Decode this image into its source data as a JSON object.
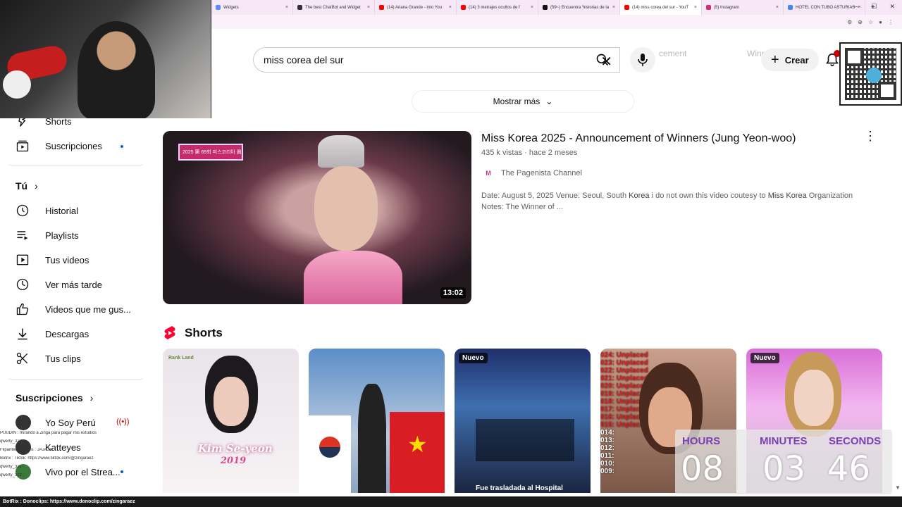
{
  "browser": {
    "tabs": [
      {
        "label": "Widgets",
        "color": "#5b8cff"
      },
      {
        "label": "The best ChatBot and Widget",
        "color": "#333"
      },
      {
        "label": "(14) Ariana Grande - Into You",
        "color": "#ff0000"
      },
      {
        "label": "(14) 3 metrajes ocultos de f",
        "color": "#ff0000"
      },
      {
        "label": "(59~) Encuentra 'historias de la",
        "color": "#111"
      },
      {
        "label": "(14) miss corea del sur - YouT",
        "color": "#ff0000"
      },
      {
        "label": "(5) Instagram",
        "color": "#d62976"
      },
      {
        "label": "HOTEL CON TUBO ASTURIAS",
        "color": "#4285f4"
      }
    ],
    "active_tab": 5
  },
  "header": {
    "search_value": "miss corea del sur",
    "create_label": "Crear",
    "ghost_text_1": "cement",
    "ghost_text_2": "Winner of Miss"
  },
  "show_more_label": "Mostrar más",
  "sidebar": {
    "top_items": [
      {
        "label": "Shorts",
        "icon": "shorts-icon"
      },
      {
        "label": "Suscripciones",
        "icon": "subscriptions-icon"
      }
    ],
    "you_label": "Tú",
    "you_items": [
      {
        "label": "Historial",
        "icon": "history-icon"
      },
      {
        "label": "Playlists",
        "icon": "playlists-icon"
      },
      {
        "label": "Tus videos",
        "icon": "your-videos-icon"
      },
      {
        "label": "Ver más tarde",
        "icon": "watch-later-icon"
      },
      {
        "label": "Videos que me gus...",
        "icon": "liked-icon"
      },
      {
        "label": "Descargas",
        "icon": "downloads-icon"
      },
      {
        "label": "Tus clips",
        "icon": "clips-icon"
      }
    ],
    "subs_label": "Suscripciones",
    "subs": [
      {
        "label": "Yo Soy Perú"
      },
      {
        "label": "Katteyes"
      },
      {
        "label": "Vivo por el Strea..."
      }
    ]
  },
  "video": {
    "title": "Miss Korea 2025 - Announcement of Winners (Jung Yeon-woo)",
    "views": "435 k vistas",
    "sep": "·",
    "age": "hace 2 meses",
    "channel": "The Pagenista Channel",
    "desc_1": "Date: August 5, 2025 Venue: Seoul, South ",
    "desc_b1": "Korea",
    "desc_2": " i do not own this video coutesy to ",
    "desc_b2": "Miss Korea",
    "desc_3": " Organization Notes: The Winner of ...",
    "duration": "13:02",
    "thumb_tag": "2025 第 69회 미스코리아 眞"
  },
  "shorts": {
    "heading": "Shorts",
    "items": [
      {
        "badge": "",
        "overlay": "Kim Se-yeon",
        "overlay2": "2019",
        "logo": "Rank Land"
      },
      {
        "badge": "",
        "overlay": "",
        "overlay2": "",
        "logo": ""
      },
      {
        "badge": "Nuevo",
        "overlay": "Fue trasladada al Hospital",
        "overlay2": "",
        "logo": ""
      },
      {
        "badge": "",
        "overlay": "",
        "overlay2": "",
        "logo": ""
      },
      {
        "badge": "Nuevo",
        "overlay": "",
        "overlay2": "",
        "logo": ""
      }
    ],
    "placements": [
      "024: Unplaced",
      "023: Unplaced",
      "022: Unplaced",
      "021: Unplaced",
      "020: Unplaced",
      "019: Unplaced",
      "018: Unplaced",
      "017: Unplaced",
      "016: Unplaced",
      "015: Unplaced",
      "014:",
      "013:",
      "012:",
      "011:",
      "010:",
      "009:"
    ]
  },
  "timer": {
    "hours_label": "HOURS",
    "minutes_label": "MINUTES",
    "seconds_label": "SECONDS",
    "hours": "08",
    "minutes": "03",
    "seconds": "46"
  },
  "chat": {
    "lines": [
      "PUUDIN : mirando a Zinga para pagar mis estudios",
      "qwerty_322 :",
      "FlipanteDeMillans : JAJAJA",
      "Botrix : Tiktok: https://www.tiktok.com/@zingaraez",
      "qwerty_322 :",
      "qwerty_322 :"
    ],
    "bottom": "BotRix : Donoclips: https://www.donoclip.com/zingaraez"
  }
}
